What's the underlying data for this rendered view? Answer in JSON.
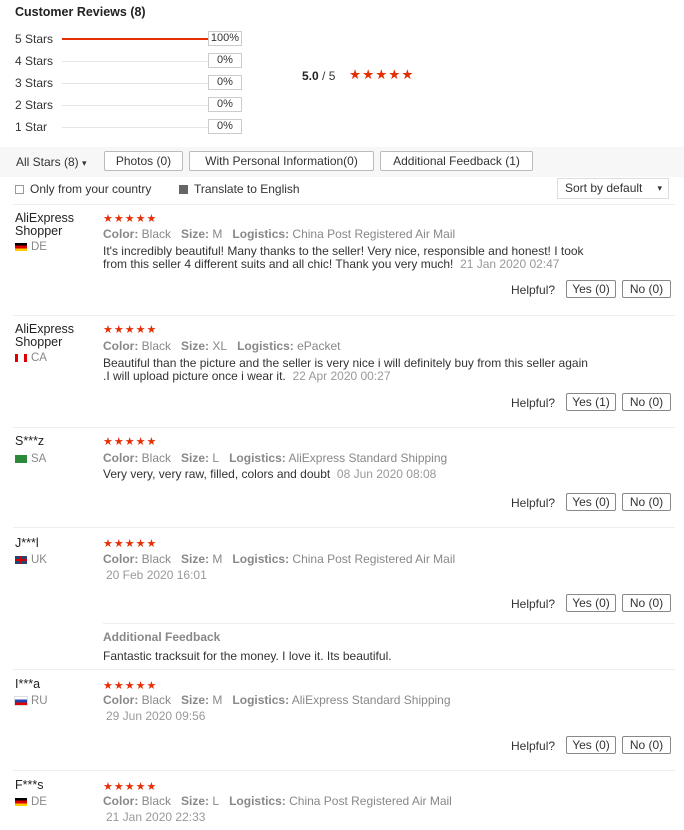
{
  "header": {
    "title": "Customer Reviews (8)"
  },
  "distribution": [
    {
      "label": "5 Stars",
      "percent": "100%",
      "fill": 1.0
    },
    {
      "label": "4 Stars",
      "percent": "0%",
      "fill": 0
    },
    {
      "label": "3 Stars",
      "percent": "0%",
      "fill": 0
    },
    {
      "label": "2 Stars",
      "percent": "0%",
      "fill": 0
    },
    {
      "label": "1 Star",
      "percent": "0%",
      "fill": 0
    }
  ],
  "average": {
    "score": "5.0",
    "out_of": " / 5",
    "stars": "★★★★★"
  },
  "filters": {
    "all_stars": "All Stars (8)",
    "photos": "Photos (0)",
    "personal": "With Personal Information(0)",
    "additional": "Additional Feedback (1)",
    "only_country": "Only from your country",
    "translate": "Translate to English",
    "sort": "Sort by default"
  },
  "helpful_label": "Helpful?",
  "attr_labels": {
    "color": "Color:",
    "size": "Size:",
    "logistics": "Logistics:"
  },
  "reviews": [
    {
      "name": "AliExpress Shopper",
      "country": "DE",
      "stars": "★★★★★",
      "color": "Black",
      "size": "M",
      "logistics": "China Post Registered Air Mail",
      "text": "It's incredibly beautiful! Many thanks to the seller! Very nice, responsible and honest! I took from this seller 4 different suits and all chic! Thank you very much!",
      "date": "21 Jan 2020 02:47",
      "yes": "Yes (0)",
      "no": "No (0)"
    },
    {
      "name": "AliExpress Shopper",
      "country": "CA",
      "stars": "★★★★★",
      "color": "Black",
      "size": "XL",
      "logistics": "ePacket",
      "text": "Beautiful than the picture and the seller is very nice i will definitely buy from this seller again .I will upload picture once i wear it.",
      "date": "22 Apr 2020 00:27",
      "yes": "Yes (1)",
      "no": "No (0)"
    },
    {
      "name": "S***z",
      "country": "SA",
      "stars": "★★★★★",
      "color": "Black",
      "size": "L",
      "logistics": "AliExpress Standard Shipping",
      "text": "Very very, very raw, filled, colors and doubt",
      "date": "08 Jun 2020 08:08",
      "yes": "Yes (0)",
      "no": "No (0)"
    },
    {
      "name": "J***l",
      "country": "UK",
      "stars": "★★★★★",
      "color": "Black",
      "size": "M",
      "logistics": "China Post Registered Air Mail",
      "date": "20 Feb 2020 16:01",
      "yes": "Yes (0)",
      "no": "No (0)",
      "additional_title": "Additional Feedback",
      "additional_text": "Fantastic tracksuit for the money. I love it. Its beautiful."
    },
    {
      "name": "I***a",
      "country": "RU",
      "stars": "★★★★★",
      "color": "Black",
      "size": "M",
      "logistics": "AliExpress Standard Shipping",
      "date": "29 Jun 2020 09:56",
      "yes": "Yes (0)",
      "no": "No (0)"
    },
    {
      "name": "F***s",
      "country": "DE",
      "stars": "★★★★★",
      "color": "Black",
      "size": "L",
      "logistics": "China Post Registered Air Mail",
      "date": "21 Jan 2020 22:33"
    }
  ],
  "colors": {
    "accent": "#e62e04"
  }
}
